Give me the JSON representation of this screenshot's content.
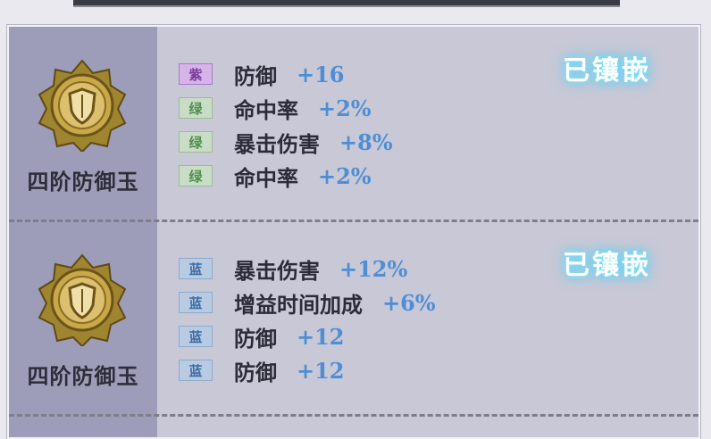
{
  "gems": [
    {
      "name": "四阶防御玉",
      "status": "已镶嵌",
      "icon": "shield-medal-icon",
      "stats": [
        {
          "quality": "紫",
          "color": "purple",
          "attr": "防御",
          "value": "+16"
        },
        {
          "quality": "绿",
          "color": "green",
          "attr": "命中率",
          "value": "+2%"
        },
        {
          "quality": "绿",
          "color": "green",
          "attr": "暴击伤害",
          "value": "+8%"
        },
        {
          "quality": "绿",
          "color": "green",
          "attr": "命中率",
          "value": "+2%"
        }
      ]
    },
    {
      "name": "四阶防御玉",
      "status": "已镶嵌",
      "icon": "shield-medal-icon",
      "stats": [
        {
          "quality": "蓝",
          "color": "blue",
          "attr": "暴击伤害",
          "value": "+12%"
        },
        {
          "quality": "蓝",
          "color": "blue",
          "attr": "增益时间加成",
          "value": "+6%"
        },
        {
          "quality": "蓝",
          "color": "blue",
          "attr": "防御",
          "value": "+12"
        },
        {
          "quality": "蓝",
          "color": "blue",
          "attr": "防御",
          "value": "+12"
        }
      ]
    }
  ],
  "colors": {
    "quality_purple": "#7c3a9e",
    "quality_green": "#4f8e4a",
    "quality_blue": "#3e6aa4",
    "value_blue": "#4f8ed4",
    "status_glow": "#7fe6ff"
  }
}
